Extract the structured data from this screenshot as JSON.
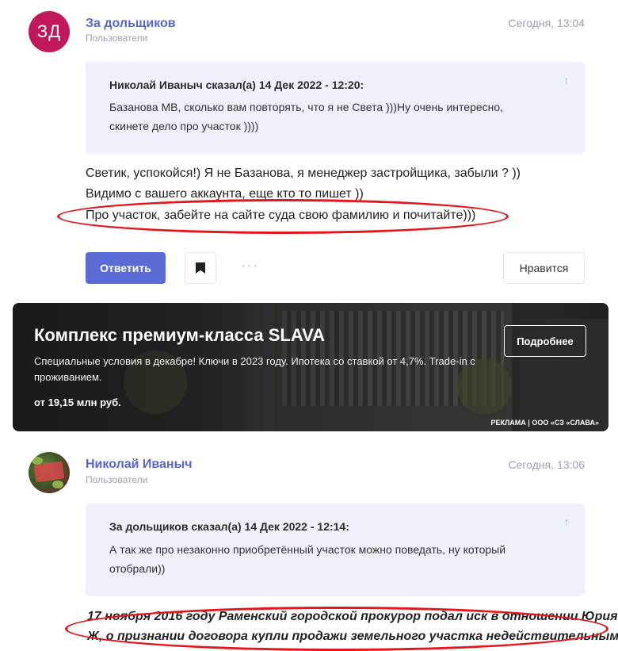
{
  "post1": {
    "avatar_initials": "ЗД",
    "author": "За дольщиков",
    "role": "Пользователи",
    "time": "Сегодня, 13:04",
    "quote": {
      "header": "Николай Иваныч сказал(а) 14 Дек 2022 - 12:20:",
      "text": "Базанова МВ, сколько вам повторять, что я не Света )))Ну очень интересно, скинете дело про участок ))))"
    },
    "body": [
      "Светик, успокойся!)  Я не Базанова, я менеджер застройщика, забыли ? ))",
      "Видимо с вашего аккаунта, еще кто то пишет ))",
      "Про участок, забейте на сайте суда свою фамилию и почитайте)))"
    ],
    "actions": {
      "reply": "Ответить",
      "more": "···",
      "like": "Нравится"
    }
  },
  "ad": {
    "title": "Комплекс премиум-класса SLAVA",
    "description": "Специальные условия в декабре! Ключи в 2023 году. Ипотека со ставкой от 4,7%. Trade-in с проживанием.",
    "price": "от 19,15 млн руб.",
    "button": "Подробнее",
    "label": "РЕКЛАМА | ООО «СЗ «СЛАВА»"
  },
  "post2": {
    "author": "Николай Иваныч",
    "role": "Пользователи",
    "time": "Сегодня, 13:06",
    "quote": {
      "header": "За дольщиков сказал(а) 14 Дек 2022 - 12:14:",
      "text": "А так же про незаконно приобретённый участок можно поведать, ну который отобрали))"
    },
    "body": [
      "17 ноября 2016 году Раменский городской прокурор подал иск в отношении Юрия",
      "Ж, о признании  договора купли продажи земельного участка недействительным,"
    ]
  },
  "colors": {
    "accent": "#5a6bd6",
    "author_link": "#5867c7",
    "avatar_bg": "#c0185a",
    "quote_bg": "#eef0fb",
    "highlight_red": "#e5161b"
  }
}
